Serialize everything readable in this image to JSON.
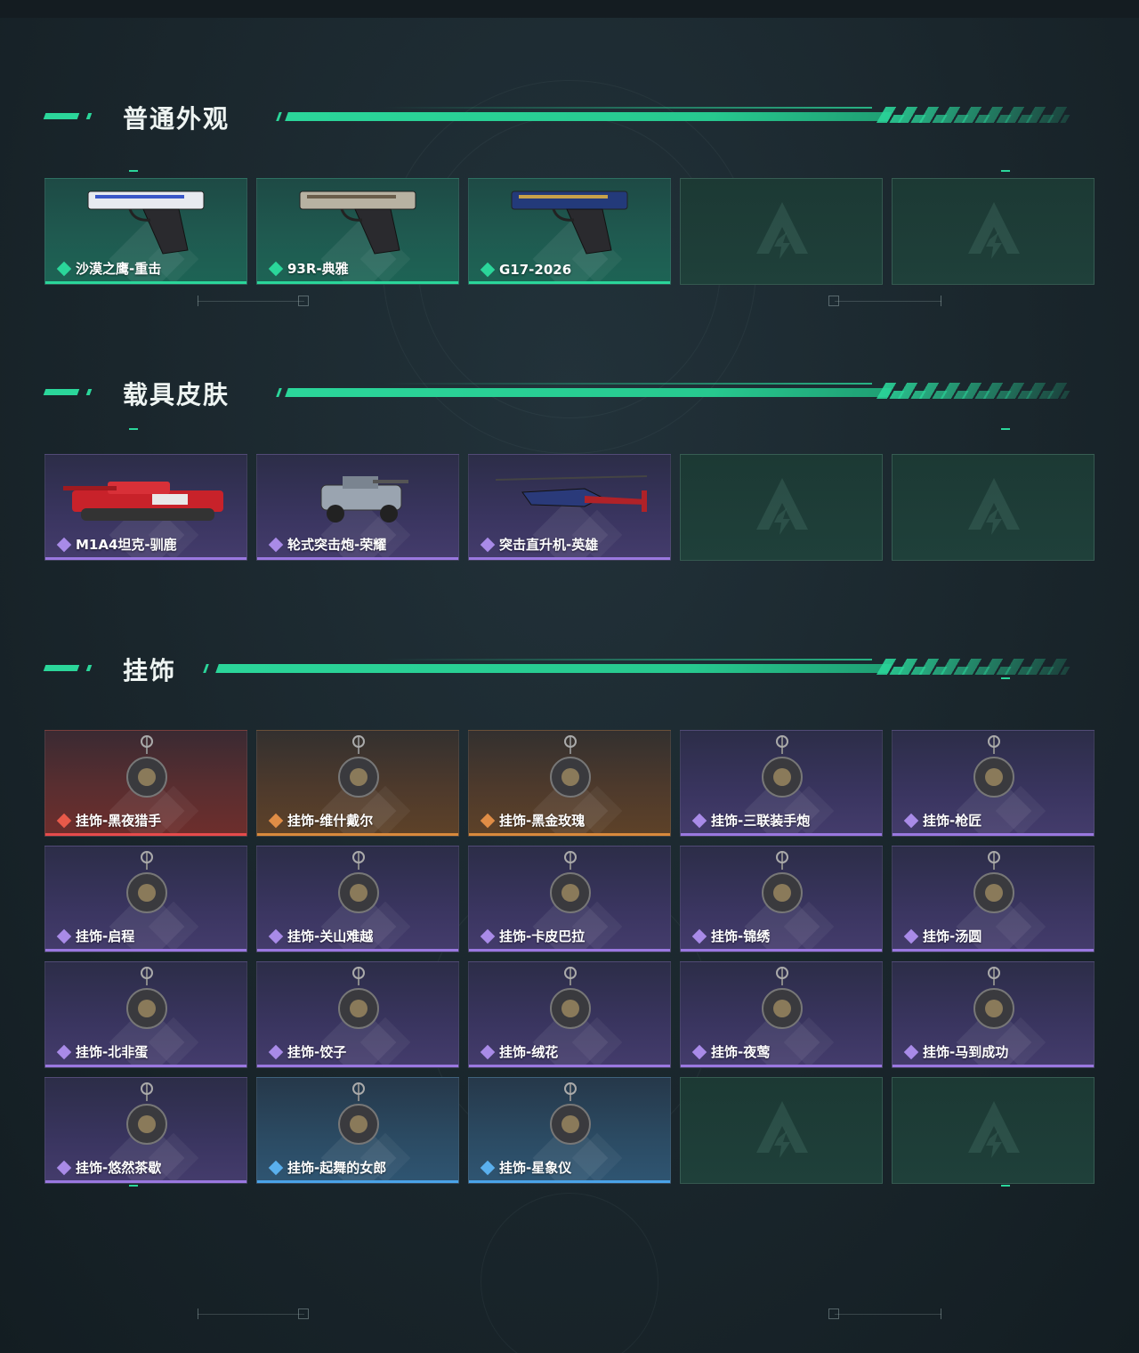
{
  "sections": [
    {
      "title": "普通外观",
      "items": [
        {
          "label": "沙漠之鹰-重击",
          "rarity": "green",
          "icon": "pistol-icon"
        },
        {
          "label": "93R-典雅",
          "rarity": "green",
          "icon": "pistol-icon"
        },
        {
          "label": "G17-2026",
          "rarity": "green",
          "icon": "pistol-icon"
        },
        {
          "label": "",
          "rarity": "empty",
          "icon": "logo-placeholder-icon"
        },
        {
          "label": "",
          "rarity": "empty",
          "icon": "logo-placeholder-icon"
        }
      ]
    },
    {
      "title": "载具皮肤",
      "items": [
        {
          "label": "M1A4坦克-驯鹿",
          "rarity": "purple",
          "icon": "tank-icon"
        },
        {
          "label": "轮式突击炮-荣耀",
          "rarity": "purple",
          "icon": "armored-car-icon"
        },
        {
          "label": "突击直升机-英雄",
          "rarity": "purple",
          "icon": "helicopter-icon"
        },
        {
          "label": "",
          "rarity": "empty",
          "icon": "logo-placeholder-icon"
        },
        {
          "label": "",
          "rarity": "empty",
          "icon": "logo-placeholder-icon"
        }
      ]
    },
    {
      "title": "挂饰",
      "items": [
        {
          "label": "挂饰-黑夜猎手",
          "rarity": "red",
          "icon": "charm-icon"
        },
        {
          "label": "挂饰-维什戴尔",
          "rarity": "orange",
          "icon": "charm-icon"
        },
        {
          "label": "挂饰-黑金玫瑰",
          "rarity": "orange",
          "icon": "charm-icon"
        },
        {
          "label": "挂饰-三联装手炮",
          "rarity": "purple",
          "icon": "charm-icon"
        },
        {
          "label": "挂饰-枪匠",
          "rarity": "purple",
          "icon": "charm-icon"
        },
        {
          "label": "挂饰-启程",
          "rarity": "purple",
          "icon": "charm-icon"
        },
        {
          "label": "挂饰-关山难越",
          "rarity": "purple",
          "icon": "charm-icon"
        },
        {
          "label": "挂饰-卡皮巴拉",
          "rarity": "purple",
          "icon": "charm-icon"
        },
        {
          "label": "挂饰-锦绣",
          "rarity": "purple",
          "icon": "charm-icon"
        },
        {
          "label": "挂饰-汤圆",
          "rarity": "purple",
          "icon": "charm-icon"
        },
        {
          "label": "挂饰-北非蛋",
          "rarity": "purple",
          "icon": "charm-icon"
        },
        {
          "label": "挂饰-饺子",
          "rarity": "purple",
          "icon": "charm-icon"
        },
        {
          "label": "挂饰-绒花",
          "rarity": "purple",
          "icon": "charm-icon"
        },
        {
          "label": "挂饰-夜莺",
          "rarity": "purple",
          "icon": "charm-icon"
        },
        {
          "label": "挂饰-马到成功",
          "rarity": "purple",
          "icon": "charm-icon"
        },
        {
          "label": "挂饰-悠然茶歇",
          "rarity": "purple",
          "icon": "charm-icon"
        },
        {
          "label": "挂饰-起舞的女郎",
          "rarity": "blue",
          "icon": "charm-icon"
        },
        {
          "label": "挂饰-星象仪",
          "rarity": "blue",
          "icon": "charm-icon"
        },
        {
          "label": "",
          "rarity": "empty",
          "icon": "logo-placeholder-icon"
        },
        {
          "label": "",
          "rarity": "empty",
          "icon": "logo-placeholder-icon"
        }
      ]
    }
  ],
  "colors": {
    "accent": "#2bd69a",
    "green": "#2bd69a",
    "purple": "#9a78e0",
    "red": "#e64b4b",
    "orange": "#d98a3c",
    "blue": "#4aa3e8"
  }
}
